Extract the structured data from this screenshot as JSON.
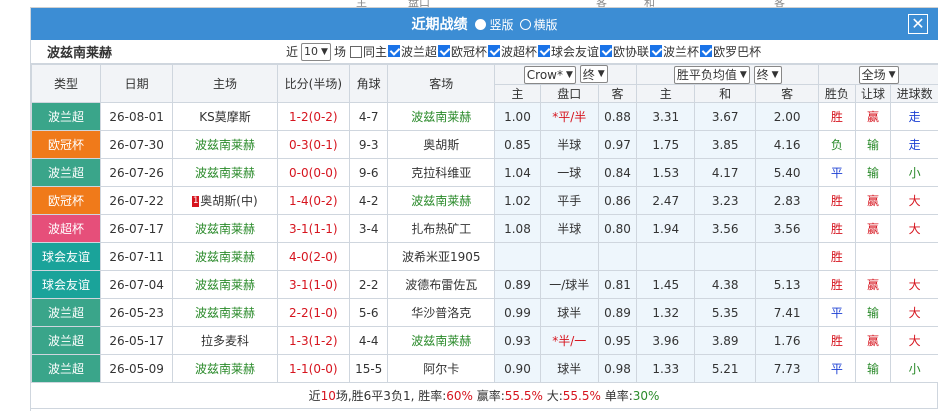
{
  "top_strip": {
    "labels": [
      "主",
      "盘口",
      "客",
      "和",
      "客"
    ]
  },
  "titlebar": {
    "title": "近期战绩",
    "radio_vertical": "竖版",
    "radio_horizontal": "横版",
    "close": "✕"
  },
  "filterbar": {
    "team": "波兹南莱赫",
    "near_label": "近",
    "count_value": "10",
    "field_label": "场",
    "same_home_label": "同主",
    "competitions": [
      "波兰超",
      "欧冠杯",
      "波超杯",
      "球会友谊",
      "欧协联",
      "波兰杯",
      "欧罗巴杯"
    ]
  },
  "headers": {
    "type": "类型",
    "date": "日期",
    "home": "主场",
    "score": "比分(半场)",
    "corner": "角球",
    "away": "客场",
    "company": "Crow*",
    "handicap_scope": "终",
    "euro_type": "胜平负均值",
    "euro_scope": "终",
    "scope": "全场",
    "hc_home": "主",
    "hc_line": "盘口",
    "hc_away": "客",
    "eu_home": "主",
    "eu_draw": "和",
    "eu_away": "客",
    "result": "胜负",
    "handicap_result": "让球",
    "goals": "进球数"
  },
  "colors": {
    "header_blue": "#3c8dd4",
    "league_polish": "#3aa58a",
    "league_ucl": "#f07a1a",
    "league_cup": "#e64f7a",
    "league_friendly": "#1aa39a",
    "team_green": "#2a8a2a",
    "score_red": "#d6141e",
    "result_blue": "#1b3fd3"
  },
  "rows": [
    {
      "type": "波兰超",
      "type_color": "#3aa58a",
      "date": "26-08-01",
      "home": "KS莫摩斯",
      "home_is_team": false,
      "score": "1-2(0-2)",
      "corner": "4-7",
      "away": "波兹南莱赫",
      "away_is_team": true,
      "hc_home": "1.00",
      "hc_line": "*平/半",
      "hc_line_red": true,
      "hc_away": "0.88",
      "eu_home": "3.31",
      "eu_draw": "3.67",
      "eu_away": "2.00",
      "result": "胜",
      "result_color": "#d6141e",
      "hc_result": "赢",
      "hc_result_color": "#d6141e",
      "goals": "走",
      "goals_color": "#1b3fd3",
      "rank": ""
    },
    {
      "type": "欧冠杯",
      "type_color": "#f07a1a",
      "date": "26-07-30",
      "home": "波兹南莱赫",
      "home_is_team": true,
      "score": "0-3(0-1)",
      "corner": "9-3",
      "away": "奥胡斯",
      "away_is_team": false,
      "hc_home": "0.85",
      "hc_line": "半球",
      "hc_line_red": false,
      "hc_away": "0.97",
      "eu_home": "1.75",
      "eu_draw": "3.85",
      "eu_away": "4.16",
      "result": "负",
      "result_color": "#2a8a2a",
      "hc_result": "输",
      "hc_result_color": "#2a8a2a",
      "goals": "走",
      "goals_color": "#1b3fd3",
      "rank": ""
    },
    {
      "type": "波兰超",
      "type_color": "#3aa58a",
      "date": "26-07-26",
      "home": "波兹南莱赫",
      "home_is_team": true,
      "score": "0-0(0-0)",
      "corner": "9-6",
      "away": "克拉科维亚",
      "away_is_team": false,
      "hc_home": "1.04",
      "hc_line": "一球",
      "hc_line_red": false,
      "hc_away": "0.84",
      "eu_home": "1.53",
      "eu_draw": "4.17",
      "eu_away": "5.40",
      "result": "平",
      "result_color": "#1b3fd3",
      "hc_result": "输",
      "hc_result_color": "#2a8a2a",
      "goals": "小",
      "goals_color": "#2a8a2a",
      "rank": ""
    },
    {
      "type": "欧冠杯",
      "type_color": "#f07a1a",
      "date": "26-07-22",
      "home": "奥胡斯(中)",
      "home_is_team": false,
      "score": "1-4(0-2)",
      "corner": "4-2",
      "away": "波兹南莱赫",
      "away_is_team": true,
      "hc_home": "1.02",
      "hc_line": "平手",
      "hc_line_red": false,
      "hc_away": "0.86",
      "eu_home": "2.47",
      "eu_draw": "3.23",
      "eu_away": "2.83",
      "result": "胜",
      "result_color": "#d6141e",
      "hc_result": "赢",
      "hc_result_color": "#d6141e",
      "goals": "大",
      "goals_color": "#d6141e",
      "rank": "1"
    },
    {
      "type": "波超杯",
      "type_color": "#e64f7a",
      "date": "26-07-17",
      "home": "波兹南莱赫",
      "home_is_team": true,
      "score": "3-1(1-1)",
      "corner": "3-4",
      "away": "扎布热矿工",
      "away_is_team": false,
      "hc_home": "1.08",
      "hc_line": "半球",
      "hc_line_red": false,
      "hc_away": "0.80",
      "eu_home": "1.94",
      "eu_draw": "3.56",
      "eu_away": "3.56",
      "result": "胜",
      "result_color": "#d6141e",
      "hc_result": "赢",
      "hc_result_color": "#d6141e",
      "goals": "大",
      "goals_color": "#d6141e",
      "rank": ""
    },
    {
      "type": "球会友谊",
      "type_color": "#1aa39a",
      "date": "26-07-11",
      "home": "波兹南莱赫",
      "home_is_team": true,
      "score": "4-0(2-0)",
      "corner": "",
      "away": "波希米亚1905",
      "away_is_team": false,
      "hc_home": "",
      "hc_line": "",
      "hc_line_red": false,
      "hc_away": "",
      "eu_home": "",
      "eu_draw": "",
      "eu_away": "",
      "result": "胜",
      "result_color": "#d6141e",
      "hc_result": "",
      "hc_result_color": "#d6141e",
      "goals": "",
      "goals_color": "#d6141e",
      "rank": ""
    },
    {
      "type": "球会友谊",
      "type_color": "#1aa39a",
      "date": "26-07-04",
      "home": "波兹南莱赫",
      "home_is_team": true,
      "score": "3-1(1-0)",
      "corner": "2-2",
      "away": "波德布雷佐瓦",
      "away_is_team": false,
      "hc_home": "0.89",
      "hc_line": "一/球半",
      "hc_line_red": false,
      "hc_away": "0.81",
      "eu_home": "1.45",
      "eu_draw": "4.38",
      "eu_away": "5.13",
      "result": "胜",
      "result_color": "#d6141e",
      "hc_result": "赢",
      "hc_result_color": "#d6141e",
      "goals": "大",
      "goals_color": "#d6141e",
      "rank": ""
    },
    {
      "type": "波兰超",
      "type_color": "#3aa58a",
      "date": "26-05-23",
      "home": "波兹南莱赫",
      "home_is_team": true,
      "score": "2-2(1-0)",
      "corner": "5-6",
      "away": "华沙普洛克",
      "away_is_team": false,
      "hc_home": "0.99",
      "hc_line": "球半",
      "hc_line_red": false,
      "hc_away": "0.89",
      "eu_home": "1.32",
      "eu_draw": "5.35",
      "eu_away": "7.41",
      "result": "平",
      "result_color": "#1b3fd3",
      "hc_result": "输",
      "hc_result_color": "#2a8a2a",
      "goals": "大",
      "goals_color": "#d6141e",
      "rank": ""
    },
    {
      "type": "波兰超",
      "type_color": "#3aa58a",
      "date": "26-05-17",
      "home": "拉多麦科",
      "home_is_team": false,
      "score": "1-3(1-2)",
      "corner": "4-4",
      "away": "波兹南莱赫",
      "away_is_team": true,
      "hc_home": "0.93",
      "hc_line": "*半/一",
      "hc_line_red": true,
      "hc_away": "0.95",
      "eu_home": "3.96",
      "eu_draw": "3.89",
      "eu_away": "1.76",
      "result": "胜",
      "result_color": "#d6141e",
      "hc_result": "赢",
      "hc_result_color": "#d6141e",
      "goals": "大",
      "goals_color": "#d6141e",
      "rank": ""
    },
    {
      "type": "波兰超",
      "type_color": "#3aa58a",
      "date": "26-05-09",
      "home": "波兹南莱赫",
      "home_is_team": true,
      "score": "1-1(0-0)",
      "corner": "15-5",
      "away": "阿尔卡",
      "away_is_team": false,
      "hc_home": "0.90",
      "hc_line": "球半",
      "hc_line_red": false,
      "hc_away": "0.98",
      "eu_home": "1.33",
      "eu_draw": "5.21",
      "eu_away": "7.73",
      "result": "平",
      "result_color": "#1b3fd3",
      "hc_result": "输",
      "hc_result_color": "#2a8a2a",
      "goals": "小",
      "goals_color": "#2a8a2a",
      "rank": ""
    }
  ],
  "footer": {
    "prefix": "近",
    "count": "10",
    "summary": "场,胜6平3负1, 胜率:",
    "win_rate": "60%",
    "hc_label": " 赢率:",
    "hc_rate": "55.5%",
    "big_label": " 大:",
    "big_rate": "55.5%",
    "odd_label": " 单率:",
    "odd_rate": "30%"
  }
}
